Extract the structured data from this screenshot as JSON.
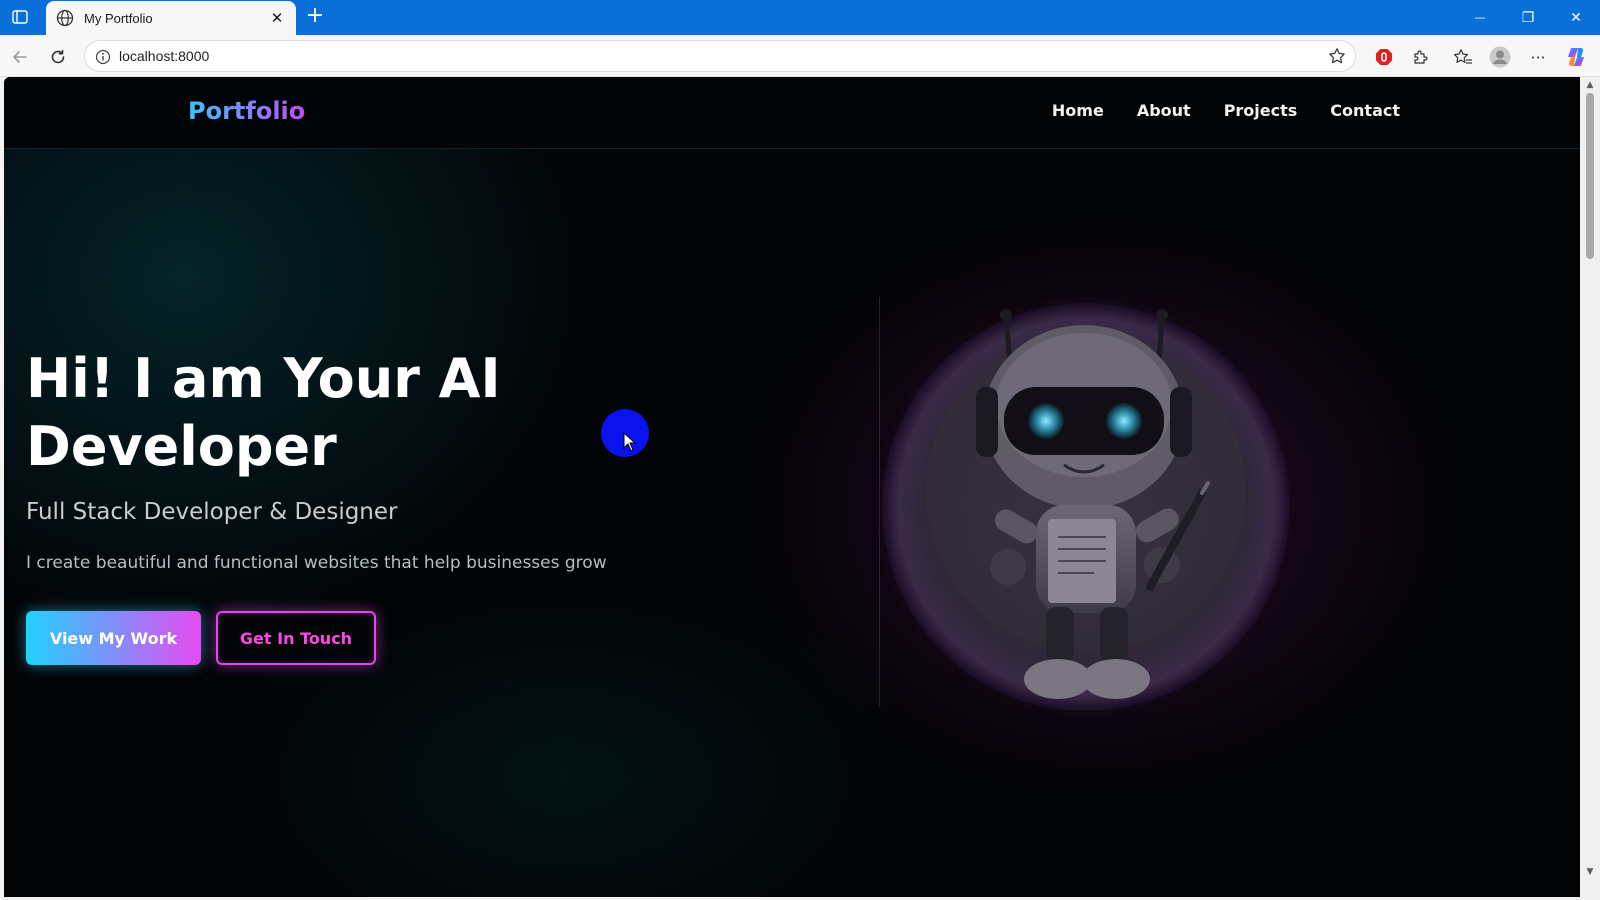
{
  "browser": {
    "tab_title": "My Portfolio",
    "tab_close": "✕",
    "new_tab": "+",
    "url": "localhost:8000",
    "window_controls": {
      "minimize": "—",
      "restore": "❐",
      "close": "✕"
    },
    "more_label": "···",
    "accent_color": "#0a6fd8"
  },
  "page": {
    "logo": "Portfolio",
    "nav": [
      {
        "label": "Home"
      },
      {
        "label": "About"
      },
      {
        "label": "Projects"
      },
      {
        "label": "Contact"
      }
    ],
    "hero": {
      "title_line1": "Hi! I am Your AI",
      "title_line2": "Developer",
      "subtitle": "Full Stack Developer & Designer",
      "description": "I create beautiful and functional websites that help businesses grow",
      "primary_button": "View My Work",
      "secondary_button": "Get In Touch"
    },
    "colors": {
      "gradient_start": "#1fd2ff",
      "gradient_end": "#e54bf2",
      "outline_accent": "#e544f0",
      "background": "#020406"
    }
  }
}
